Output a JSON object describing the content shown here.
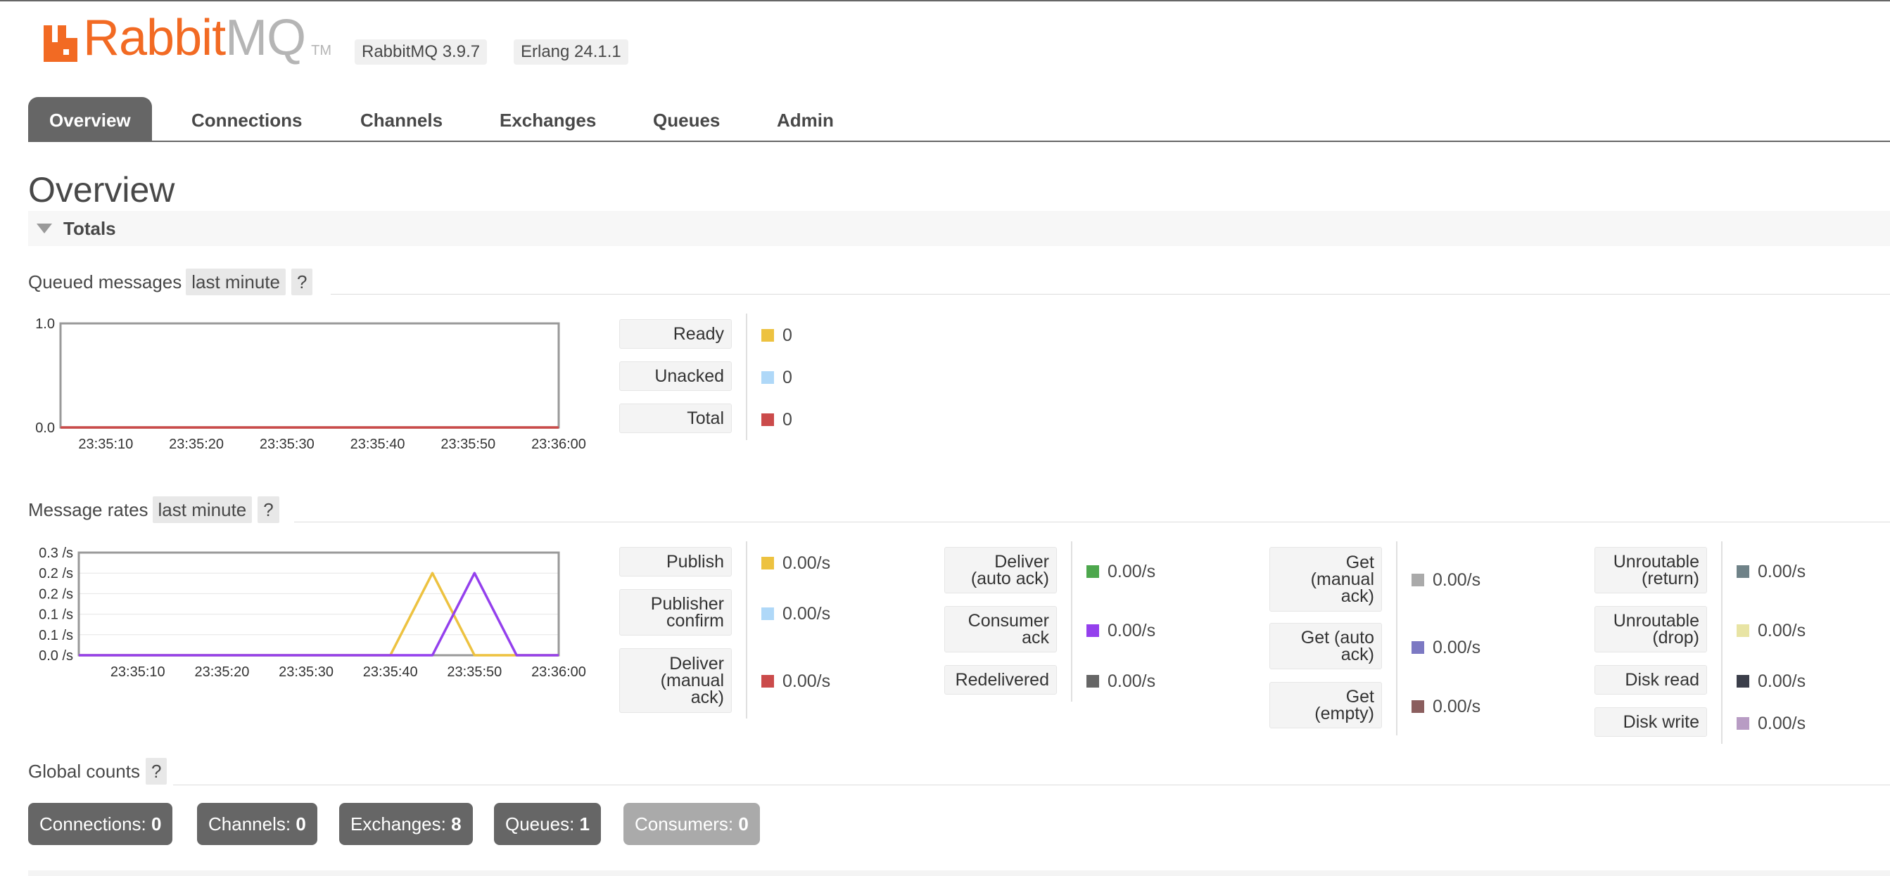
{
  "app": {
    "logo_rabbit": "Rabbit",
    "logo_mq": "MQ",
    "logo_tm": "TM",
    "version": "RabbitMQ 3.9.7",
    "erlang": "Erlang 24.1.1",
    "brand_color": "#f26a23"
  },
  "tabs": [
    {
      "label": "Overview",
      "active": true
    },
    {
      "label": "Connections",
      "active": false
    },
    {
      "label": "Channels",
      "active": false
    },
    {
      "label": "Exchanges",
      "active": false
    },
    {
      "label": "Queues",
      "active": false
    },
    {
      "label": "Admin",
      "active": false
    }
  ],
  "page": {
    "title": "Overview",
    "section": "Totals"
  },
  "queued": {
    "heading": "Queued messages",
    "range": "last minute",
    "help": "?",
    "legend": [
      {
        "label": "Ready",
        "value": "0",
        "color": "#edc240"
      },
      {
        "label": "Unacked",
        "value": "0",
        "color": "#afd8f8"
      },
      {
        "label": "Total",
        "value": "0",
        "color": "#cb4b4b"
      }
    ]
  },
  "rates": {
    "heading": "Message rates",
    "range": "last minute",
    "help": "?",
    "groups": [
      [
        {
          "label": "Publish",
          "value": "0.00/s",
          "color": "#edc240"
        },
        {
          "label": "Publisher\nconfirm",
          "value": "0.00/s",
          "color": "#afd8f8"
        },
        {
          "label": "Deliver\n(manual\nack)",
          "value": "0.00/s",
          "color": "#cb4b4b"
        }
      ],
      [
        {
          "label": "Deliver\n(auto ack)",
          "value": "0.00/s",
          "color": "#4da74d"
        },
        {
          "label": "Consumer\nack",
          "value": "0.00/s",
          "color": "#9440ed"
        },
        {
          "label": "Redelivered",
          "value": "0.00/s",
          "color": "#666666"
        }
      ],
      [
        {
          "label": "Get\n(manual\nack)",
          "value": "0.00/s",
          "color": "#aaaaaa"
        },
        {
          "label": "Get (auto\nack)",
          "value": "0.00/s",
          "color": "#7c79c3"
        },
        {
          "label": "Get\n(empty)",
          "value": "0.00/s",
          "color": "#8b5e5e"
        }
      ],
      [
        {
          "label": "Unroutable\n(return)",
          "value": "0.00/s",
          "color": "#6f8288"
        },
        {
          "label": "Unroutable\n(drop)",
          "value": "0.00/s",
          "color": "#e8e4a4"
        },
        {
          "label": "Disk read",
          "value": "0.00/s",
          "color": "#3b3e4a"
        },
        {
          "label": "Disk write",
          "value": "0.00/s",
          "color": "#b89cc4"
        }
      ]
    ]
  },
  "global": {
    "heading": "Global counts",
    "help": "?",
    "counts": [
      {
        "label": "Connections:",
        "value": "0"
      },
      {
        "label": "Channels:",
        "value": "0"
      },
      {
        "label": "Exchanges:",
        "value": "8"
      },
      {
        "label": "Queues:",
        "value": "1"
      },
      {
        "label": "Consumers:",
        "value": "0"
      }
    ]
  },
  "chart_data": [
    {
      "type": "line",
      "title": "Queued messages",
      "x": [
        "23:35:05",
        "23:35:10",
        "23:35:20",
        "23:35:30",
        "23:35:40",
        "23:35:50",
        "23:36:00"
      ],
      "x_ticks": [
        "23:35:10",
        "23:35:20",
        "23:35:30",
        "23:35:40",
        "23:35:50",
        "23:36:00"
      ],
      "y_ticks": [
        "1.0",
        "0.0"
      ],
      "ylim": [
        0,
        1.0
      ],
      "series": [
        {
          "name": "Ready",
          "color": "#edc240",
          "values": [
            0,
            0,
            0,
            0,
            0,
            0,
            0
          ]
        },
        {
          "name": "Unacked",
          "color": "#afd8f8",
          "values": [
            0,
            0,
            0,
            0,
            0,
            0,
            0
          ]
        },
        {
          "name": "Total",
          "color": "#cb4b4b",
          "values": [
            0,
            0,
            0,
            0,
            0,
            0,
            0
          ]
        }
      ]
    },
    {
      "type": "line",
      "title": "Message rates",
      "x": [
        "23:35:03",
        "23:35:40",
        "23:35:45",
        "23:35:50",
        "23:35:55",
        "23:36:00"
      ],
      "x_ticks": [
        "23:35:10",
        "23:35:20",
        "23:35:30",
        "23:35:40",
        "23:35:50",
        "23:36:00"
      ],
      "y_ticks": [
        "0.3 /s",
        "0.2 /s",
        "0.2 /s",
        "0.1 /s",
        "0.1 /s",
        "0.0 /s"
      ],
      "ylim": [
        0,
        0.25
      ],
      "series": [
        {
          "name": "Publish",
          "color": "#edc240",
          "values": [
            0,
            0,
            0.2,
            0,
            0,
            0
          ]
        },
        {
          "name": "Consumer ack",
          "color": "#9440ed",
          "values": [
            0,
            0,
            0,
            0.2,
            0,
            0
          ]
        }
      ]
    }
  ]
}
